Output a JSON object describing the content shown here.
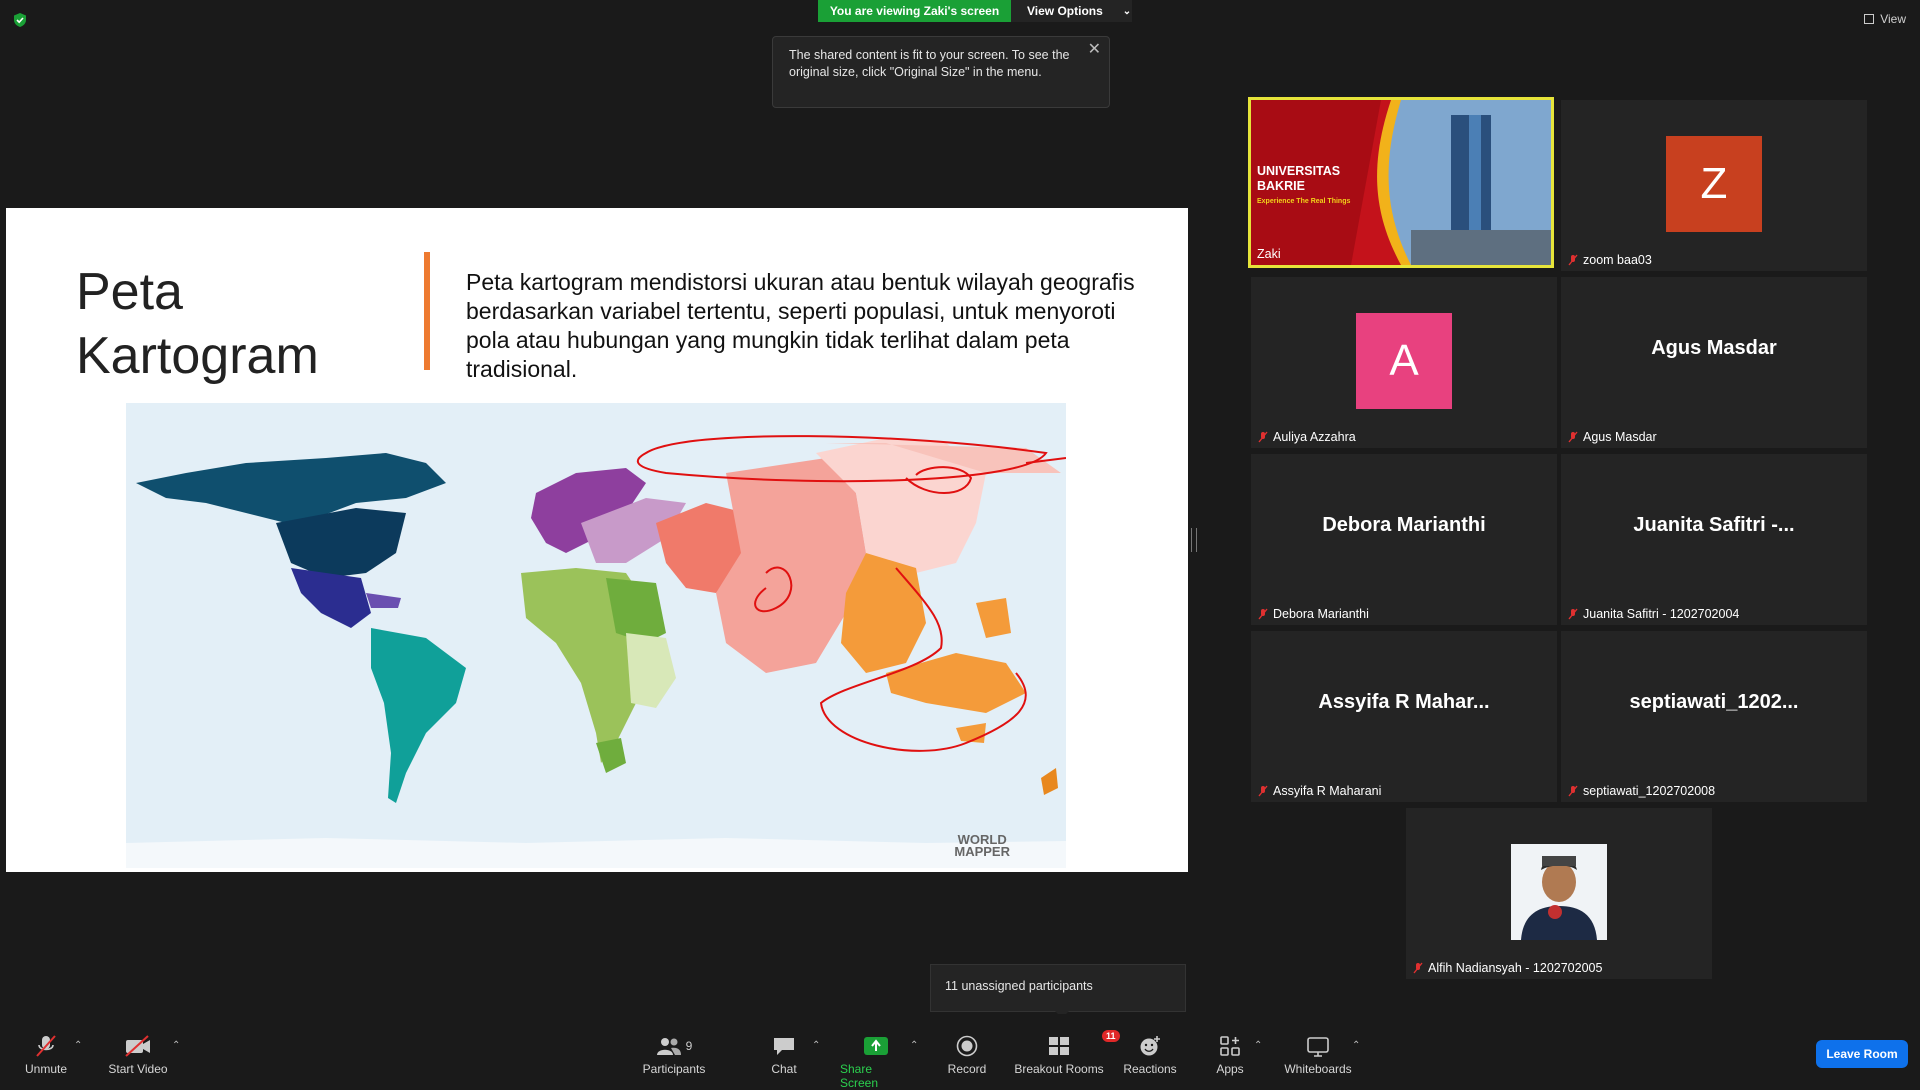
{
  "top": {
    "viewing_label": "You are viewing Zaki's screen",
    "view_options_label": "View Options",
    "view_label": "View"
  },
  "tooltip": {
    "text": "The shared content is fit to your screen. To see the original size, click \"Original Size\" in the menu."
  },
  "slide": {
    "title_line1": "Peta",
    "title_line2": "Kartogram",
    "body": "Peta kartogram mendistorsi ukuran atau bentuk wilayah geografis berdasarkan variabel tertentu, seperti populasi, untuk menyoroti pola atau hubungan yang mungkin tidak terlihat dalam peta tradisional.",
    "map_logo_line1": "WORLD",
    "map_logo_line2": "MAPPER"
  },
  "gallery": {
    "zaki": {
      "name": "Zaki",
      "slide_title1": "UNIVERSITAS",
      "slide_title2": "BAKRIE",
      "slide_tagline": "Experience The Real Things"
    },
    "tiles": [
      {
        "center": "Z",
        "name": "zoom baa03",
        "avatar_color": "#c8401f"
      },
      {
        "center": "A",
        "name": "Auliya Azzahra",
        "avatar_color": "#e8417f"
      },
      {
        "center": "Agus Masdar",
        "name": "Agus Masdar"
      },
      {
        "center": "Debora Marianthi",
        "name": "Debora Marianthi"
      },
      {
        "center": "Juanita Safitri -...",
        "name": "Juanita Safitri - 1202702004"
      },
      {
        "center": "Assyifa R Mahar...",
        "name": "Assyifa R Maharani"
      },
      {
        "center": "septiawati_1202...",
        "name": "septiawati_1202702008"
      },
      {
        "name": "Alfih Nadiansyah - 1202702005"
      }
    ]
  },
  "popover": {
    "unassigned": "11 unassigned participants"
  },
  "toolbar": {
    "unmute": "Unmute",
    "start_video": "Start Video",
    "participants": "Participants",
    "participants_count": "9",
    "chat": "Chat",
    "share_screen": "Share Screen",
    "record": "Record",
    "breakout_rooms": "Breakout Rooms",
    "breakout_badge": "11",
    "reactions": "Reactions",
    "apps": "Apps",
    "whiteboards": "Whiteboards",
    "leave": "Leave Room"
  },
  "colors": {
    "share_green": "#1aa036",
    "active_speaker": "#e6e43a",
    "leave_blue": "#0e71eb",
    "slide_accent": "#ee7a30"
  }
}
